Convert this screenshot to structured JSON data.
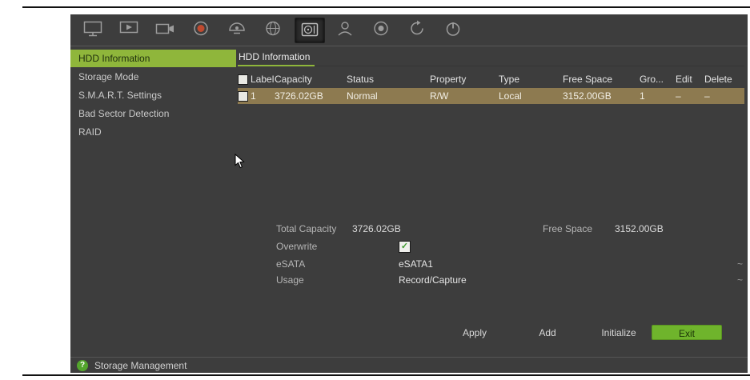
{
  "colors": {
    "panel_bg": "#3d3d3d",
    "accent_green": "#8fb63b",
    "row_highlight": "#8d7a50",
    "exit_button_green": "#6fb42c",
    "alarm_red": "#c04a2f"
  },
  "toolbar": {
    "buttons": [
      {
        "icon": "display-icon",
        "selected": false
      },
      {
        "icon": "live-view-icon",
        "selected": false
      },
      {
        "icon": "camera-icon",
        "selected": false
      },
      {
        "icon": "alarm-icon",
        "selected": false
      },
      {
        "icon": "ptz-icon",
        "selected": false
      },
      {
        "icon": "network-icon",
        "selected": false
      },
      {
        "icon": "storage-icon",
        "selected": true
      },
      {
        "icon": "user-icon",
        "selected": false
      },
      {
        "icon": "system-icon",
        "selected": false
      },
      {
        "icon": "maintenance-icon",
        "selected": false
      },
      {
        "icon": "power-icon",
        "selected": false
      }
    ]
  },
  "sidebar": {
    "items": [
      {
        "label": "HDD Information",
        "selected": true
      },
      {
        "label": "Storage Mode",
        "selected": false
      },
      {
        "label": "S.M.A.R.T. Settings",
        "selected": false
      },
      {
        "label": "Bad Sector Detection",
        "selected": false
      },
      {
        "label": "RAID",
        "selected": false
      }
    ]
  },
  "main": {
    "tab_title": "HDD Information",
    "table": {
      "headers": [
        "Label",
        "Capacity",
        "Status",
        "Property",
        "Type",
        "Free Space",
        "Gro...",
        "Edit",
        "Delete"
      ],
      "rows": [
        {
          "label": "1",
          "capacity": "3726.02GB",
          "status": "Normal",
          "property": "R/W",
          "type": "Local",
          "free_space": "3152.00GB",
          "group": "1",
          "edit": "–",
          "delete": "–"
        }
      ]
    },
    "summary": {
      "total_capacity_label": "Total Capacity",
      "total_capacity_value": "3726.02GB",
      "free_space_label": "Free Space",
      "free_space_value": "3152.00GB"
    },
    "fields": {
      "overwrite_label": "Overwrite",
      "overwrite_checked": true,
      "check_glyph": "✓",
      "esata_label": "eSATA",
      "esata_value": "eSATA1",
      "usage_label": "Usage",
      "usage_value": "Record/Capture",
      "dropdown_caret": "~"
    },
    "buttons": {
      "apply": "Apply",
      "add": "Add",
      "initialize": "Initialize",
      "exit": "Exit"
    }
  },
  "footer": {
    "help_glyph": "?",
    "label": "Storage Management"
  }
}
